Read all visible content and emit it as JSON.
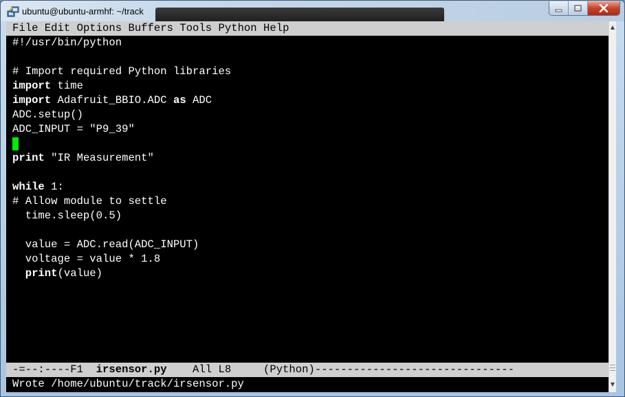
{
  "window": {
    "title": "ubuntu@ubuntu-armhf: ~/track",
    "icon": "putty-icon",
    "buttons": [
      "minimize-icon",
      "maximize-icon",
      "close-icon"
    ]
  },
  "menu": [
    "File",
    "Edit",
    "Options",
    "Buffers",
    "Tools",
    "Python",
    "Help"
  ],
  "editor": {
    "lines": [
      "#!/usr/bin/python",
      "",
      "# Import required Python libraries",
      "import time",
      "import Adafruit_BBIO.ADC as ADC",
      "ADC.setup()",
      "ADC_INPUT = \"P9_39\"",
      "",
      "print \"IR Measurement\"",
      "",
      "while 1:",
      "# Allow module to settle",
      "  time.sleep(0.5)",
      "",
      "  value = ADC.read(ADC_INPUT)",
      "  voltage = value * 1.8",
      "  print(value)"
    ]
  },
  "modeline": {
    "status": "-=--:----F1",
    "buffer": "irsensor.py",
    "position": "All L8",
    "mode": "(Python)"
  },
  "echo_area": "Wrote /home/ubuntu/track/irsensor.py",
  "colors": {
    "cursor": "#00ee00",
    "background": "#000000",
    "bars": "#cfcfcf"
  }
}
